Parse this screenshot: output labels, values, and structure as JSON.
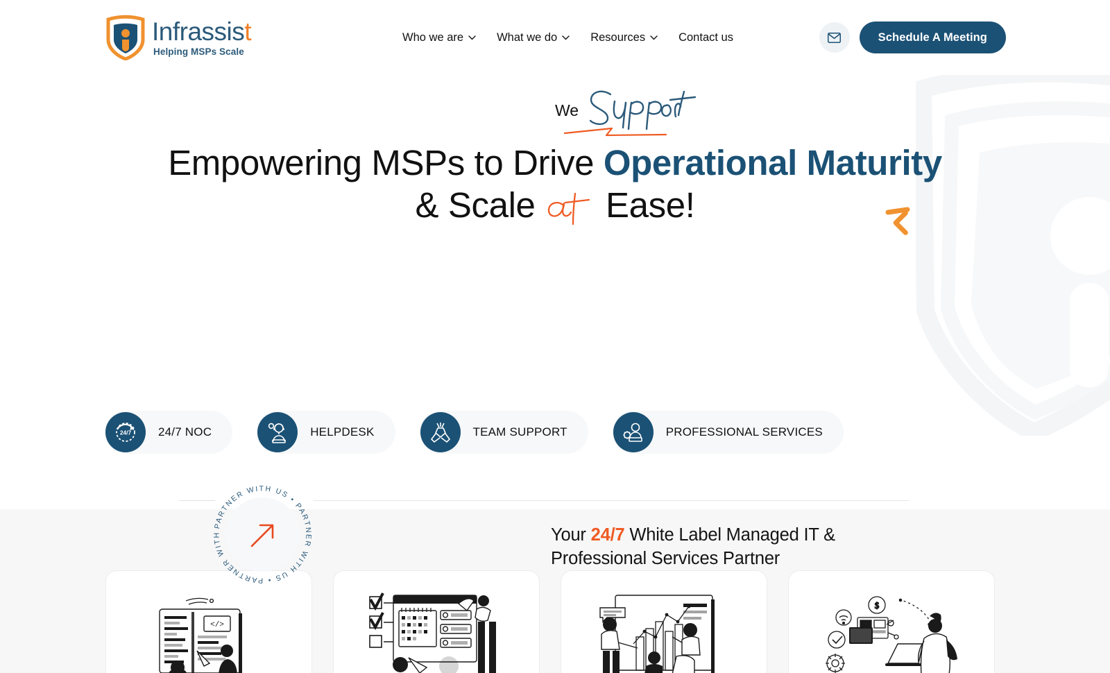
{
  "brand": {
    "name_part1": "Infrassis",
    "name_part2": "t",
    "tagline": "Helping MSPs Scale",
    "logo_icon": "shield-person-logo",
    "colors": {
      "navy": "#1b5175",
      "orange": "#ef7f29",
      "orange_accent": "#ef5b24"
    }
  },
  "header": {
    "nav": [
      {
        "label": "Who we are",
        "has_dropdown": true,
        "icon": "chevron-down-icon"
      },
      {
        "label": "What we do",
        "has_dropdown": true,
        "icon": "chevron-down-icon"
      },
      {
        "label": "Resources",
        "has_dropdown": true,
        "icon": "chevron-down-icon"
      },
      {
        "label": "Contact us",
        "has_dropdown": false,
        "icon": ""
      }
    ],
    "mail_button_icon": "mail-icon",
    "cta_label": "Schedule A Meeting"
  },
  "hero": {
    "eyebrow_plain": "We",
    "eyebrow_script": "Support",
    "headline_line1_plain": "Empowering MSPs to Drive ",
    "headline_line1_accent": "Operational Maturity",
    "headline_line2_a": "& Scale",
    "headline_line2_script": "at",
    "headline_line2_b": "Ease!",
    "decor_icon": "orange-arrow-decoration"
  },
  "badge": {
    "rotating_text": "PARTNER WITH US • PARTNER WITH US • PARTNER WITH US • ",
    "center_icon": "arrow-up-right-icon"
  },
  "subtext": {
    "before": "Your ",
    "highlight": "24/7",
    "after": " White Label Managed IT & Professional Services Partner"
  },
  "pills": [
    {
      "label": "24/7 NOC",
      "icon": "clock-24-7-icon"
    },
    {
      "label": "HELPDESK",
      "icon": "helpdesk-agent-icon"
    },
    {
      "label": "TEAM SUPPORT",
      "icon": "team-handshake-icon"
    },
    {
      "label": "PROFESSIONAL SERVICES",
      "icon": "professional-services-icon"
    }
  ],
  "cards": [
    {
      "illustration": "code-review-illustration"
    },
    {
      "illustration": "checklist-calendar-illustration"
    },
    {
      "illustration": "data-analytics-illustration"
    },
    {
      "illustration": "connected-devices-illustration"
    }
  ],
  "watermark": {
    "icon": "shield-watermark"
  }
}
